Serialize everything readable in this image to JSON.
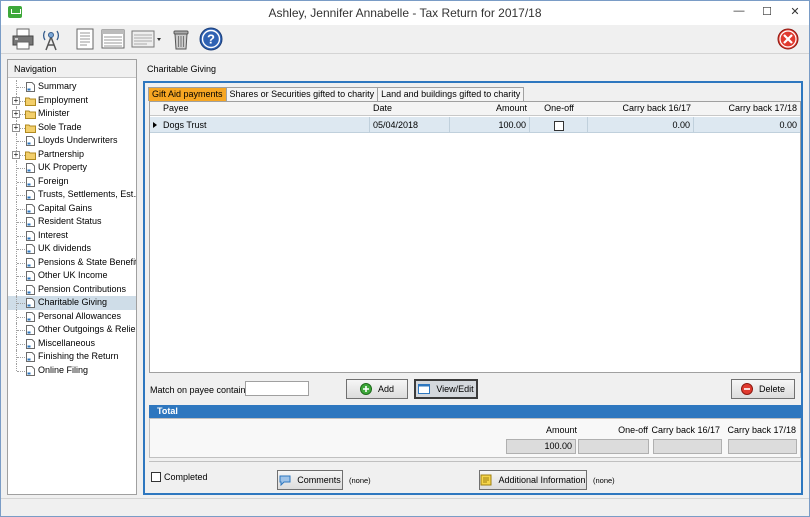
{
  "window": {
    "title": "Ashley, Jennifer Annabelle - Tax Return for 2017/18"
  },
  "navigation": {
    "header": "Navigation",
    "items": [
      {
        "label": "Summary",
        "selected": false,
        "expandable": false
      },
      {
        "label": "Employment",
        "selected": false,
        "expandable": true
      },
      {
        "label": "Minister",
        "selected": false,
        "expandable": true
      },
      {
        "label": "Sole Trade",
        "selected": false,
        "expandable": true
      },
      {
        "label": "Lloyds Underwriters",
        "selected": false,
        "expandable": false
      },
      {
        "label": "Partnership",
        "selected": false,
        "expandable": true
      },
      {
        "label": "UK Property",
        "selected": false,
        "expandable": false
      },
      {
        "label": "Foreign",
        "selected": false,
        "expandable": false
      },
      {
        "label": "Trusts, Settlements, Est…",
        "selected": false,
        "expandable": false
      },
      {
        "label": "Capital Gains",
        "selected": false,
        "expandable": false
      },
      {
        "label": "Resident Status",
        "selected": false,
        "expandable": false
      },
      {
        "label": "Interest",
        "selected": false,
        "expandable": false
      },
      {
        "label": "UK dividends",
        "selected": false,
        "expandable": false
      },
      {
        "label": "Pensions & State Benefits",
        "selected": false,
        "expandable": false
      },
      {
        "label": "Other UK Income",
        "selected": false,
        "expandable": false
      },
      {
        "label": "Pension Contributions",
        "selected": false,
        "expandable": false
      },
      {
        "label": "Charitable Giving",
        "selected": true,
        "expandable": false
      },
      {
        "label": "Personal Allowances",
        "selected": false,
        "expandable": false
      },
      {
        "label": "Other Outgoings & Relie…",
        "selected": false,
        "expandable": false
      },
      {
        "label": "Miscellaneous",
        "selected": false,
        "expandable": false
      },
      {
        "label": "Finishing the Return",
        "selected": false,
        "expandable": false
      },
      {
        "label": "Online Filing",
        "selected": false,
        "expandable": false
      }
    ]
  },
  "main": {
    "header": "Charitable Giving",
    "tabs": [
      {
        "label": "Gift Aid payments",
        "active": true
      },
      {
        "label": "Shares or Securities gifted to charity",
        "active": false
      },
      {
        "label": "Land and buildings gifted to charity",
        "active": false
      }
    ],
    "grid": {
      "columns": [
        "Payee",
        "Date",
        "Amount",
        "One-off",
        "Carry back 16/17",
        "Carry back 17/18"
      ],
      "rows": [
        {
          "payee": "Dogs Trust",
          "date": "05/04/2018",
          "amount": "100.00",
          "one_off": false,
          "carry_back_1617": "0.00",
          "carry_back_1718": "0.00"
        }
      ]
    },
    "match_label": "Match on payee contains",
    "match_value": "",
    "buttons": {
      "add": "Add",
      "view_edit": "View/Edit",
      "delete": "Delete"
    },
    "total": {
      "title": "Total",
      "labels": {
        "amount": "Amount",
        "one_off": "One-off",
        "cb1617": "Carry back 16/17",
        "cb1718": "Carry back 17/18"
      },
      "values": {
        "amount": "100.00",
        "one_off": "",
        "cb1617": "",
        "cb1718": ""
      }
    },
    "footer": {
      "completed_label": "Completed",
      "completed": false,
      "comments_label": "Comments",
      "comments_note": "(none)",
      "additional_label": "Additional Information",
      "additional_note": "(none)"
    }
  },
  "colors": {
    "accent_blue": "#2e77bf",
    "active_tab": "#f6a623",
    "selected_row": "#dde8f1",
    "exit_red": "#e03a2f"
  }
}
